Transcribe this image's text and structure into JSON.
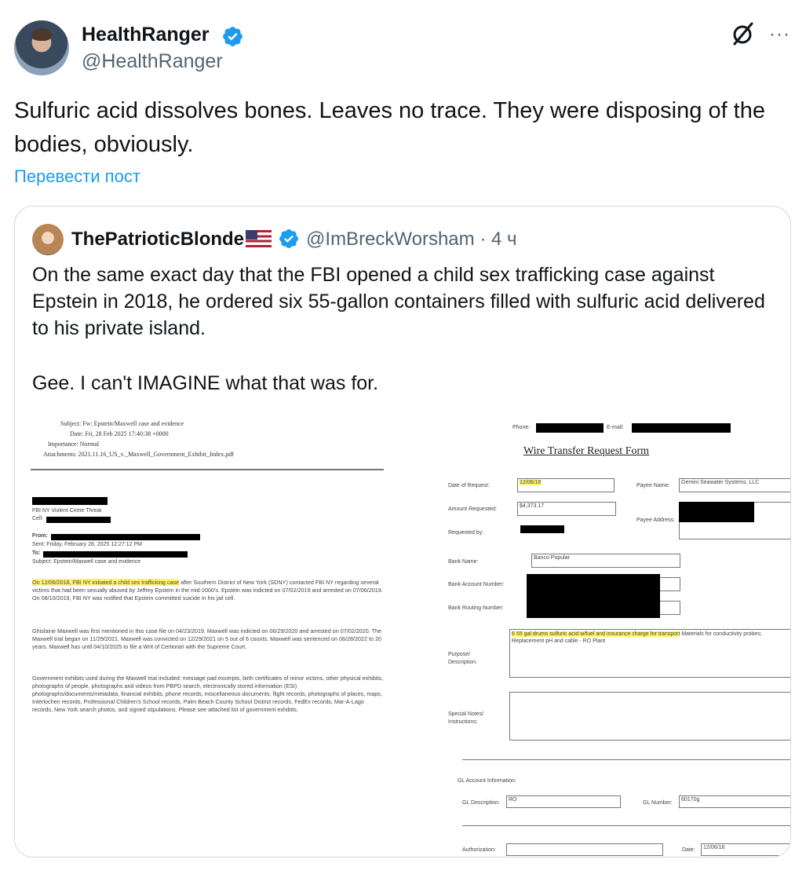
{
  "tweet": {
    "author_name": "HealthRanger",
    "author_handle": "@HealthRanger",
    "text": "Sulfuric acid dissolves bones. Leaves no trace. They were disposing of the bodies, obviously.",
    "translate_label": "Перевести пост",
    "more_label": "···",
    "icons": [
      "verified-badge-icon",
      "grok-icon",
      "more-icon"
    ]
  },
  "quote": {
    "author_name": "ThePatrioticBlonde",
    "author_handle": "@ImBreckWorsham",
    "separator": "·",
    "time": "4 ч",
    "text_p1": "On the same exact day that the FBI opened a child sex trafficking case against Epstein in 2018, he ordered six 55-gallon containers filled with sulfuric acid delivered to his private island.",
    "text_p2": "Gee. I can't IMAGINE what that was for."
  },
  "document_left": {
    "subject_line": "Subject: Fw: Epstein/Maxwell case and evidence",
    "date_line": "Date: Fri, 28 Feb 2025 17:40:38 +0000",
    "importance_line": "Importance: Normal",
    "attachments_line": "Attachments: 2021.11.16_US_v._Maxwell_Government_Exhibit_Index.pdf",
    "office_line": "FBI NY Violent Crime Threat",
    "cell_line": "Cell:",
    "from_label": "From:",
    "sent_line": "Sent: Friday, February 28, 2025 12:27:12 PM",
    "to_label": "To:",
    "subject2_line": "Subject: Epstein/Maxwell case and evidence",
    "para1_highlight": "On 12/06/2018, FBI NY initiated a child sex trafficking case",
    "para1_rest": " after Southern District of New York (SDNY) contacted FBI NY regarding several victims that had been sexually abused by Jeffrey Epstein in the mid-2000's. Epstein was indicted on 07/02/2019 and arrested on 07/06/2019. On 08/10/2019, FBI NY was notified that Epstein committed suicide in his jail cell.",
    "para2": "Ghislaine Maxwell was first mentioned in this case file on 04/23/2019. Maxwell was indicted on 06/29/2020 and arrested on 07/02/2020. The Maxwell trial began on 11/29/2021. Maxwell was convicted on 12/29/2021 on 5 out of 6 counts. Maxwell was sentenced on 06/28/2022 to 20 years. Maxwell has until 04/10/2025 to file a Writ of Certiorari with the Supreme Court.",
    "para3": "Government exhibits used during the Maxwell trial included: message pad excerpts, birth certificates of minor victims, other physical exhibits, photographs of people, photographs and videos from PBPD search, electronically stored information (ESI) photographs/documents/metadata, financial exhibits, phone records, miscellaneous documents, flight records, photographs of places, maps, Interlochen records, Professional Children's School records, Palm Beach County School District records, FedEx records, Mar-A-Lago records, New York search photos, and signed stipulations. Please see attached list of government exhibits."
  },
  "document_right": {
    "phone_label": "Phone:",
    "email_label": "E-mail:",
    "form_title": "Wire Transfer Request Form",
    "date_of_request_label": "Date of Request:",
    "date_of_request_value": "12/06/18",
    "payee_name_label": "Payee Name:",
    "payee_name_value": "Gemini Seawater Systems, LLC",
    "amount_label": "Amount Requested:",
    "amount_value": "$4,373.17",
    "payee_address_label": "Payee Address:",
    "requested_by_label": "Requested by:",
    "bank_name_label": "Bank Name:",
    "bank_name_value": "Banco Popular",
    "account_label": "Bank Account Number:",
    "routing_label": "Bank Routing Number:",
    "purpose_label": "Purpose/ Description:",
    "purpose_highlight": "6 55 gal drums sulfuric acid w/fuel and insurance charge for transport",
    "purpose_rest": " Materials for conductivity probes; Replacement pH and cable - RO Plant",
    "notes_label": "Special Notes/ Instructions:",
    "gl_info_label": "GL Account Information:",
    "gl_desc_label": "GL Description:",
    "gl_desc_value": "RO",
    "gl_number_label": "GL Number:",
    "gl_number_value": "60170g",
    "authorization_label": "Authorization:",
    "date_label": "Date:",
    "date_value": "12/06/18"
  },
  "colors": {
    "text": "#0f1419",
    "secondary": "#536471",
    "link": "#1d9bf0",
    "verified": "#1d9bf0",
    "border": "#cfd9de",
    "highlight": "#fff36b"
  }
}
